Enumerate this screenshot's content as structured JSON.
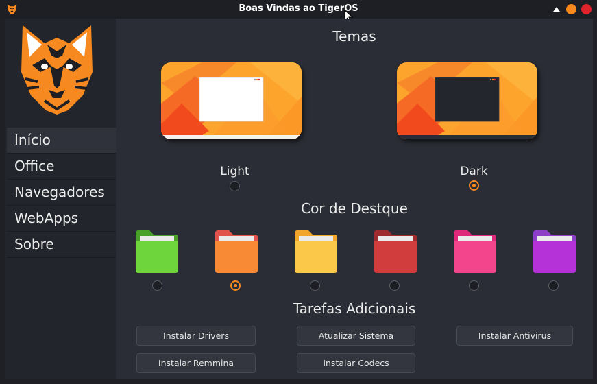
{
  "window": {
    "title": "Boas Vindas ao TigerOS"
  },
  "colors": {
    "accent": "#f6891f",
    "close": "#e0222a",
    "bg": "#2a2d35",
    "sidebar": "#22252b"
  },
  "sidebar": {
    "items": [
      {
        "label": "Início",
        "active": true
      },
      {
        "label": "Office"
      },
      {
        "label": "Navegadores"
      },
      {
        "label": "WebApps"
      },
      {
        "label": "Sobre"
      }
    ]
  },
  "themes": {
    "title": "Temas",
    "options": [
      {
        "label": "Light",
        "selected": false
      },
      {
        "label": "Dark",
        "selected": true
      }
    ]
  },
  "accent": {
    "title": "Cor de Destque",
    "colors": [
      {
        "name": "green",
        "color": "#5fcf34",
        "selected": false
      },
      {
        "name": "orange",
        "color": "#f6891f",
        "selected": true
      },
      {
        "name": "yellow",
        "color": "#fbbf3c",
        "selected": false
      },
      {
        "name": "red",
        "color": "#c9363a",
        "selected": false
      },
      {
        "name": "pink",
        "color": "#ef3e7e",
        "selected": false
      },
      {
        "name": "purple",
        "color": "#b52fd6",
        "selected": false
      }
    ]
  },
  "tasks": {
    "title": "Tarefas Adicionais",
    "buttons": [
      "Instalar Drivers",
      "Atualizar Sistema",
      "Instalar Antivirus",
      "Instalar Remmina",
      "Instalar Codecs"
    ]
  }
}
